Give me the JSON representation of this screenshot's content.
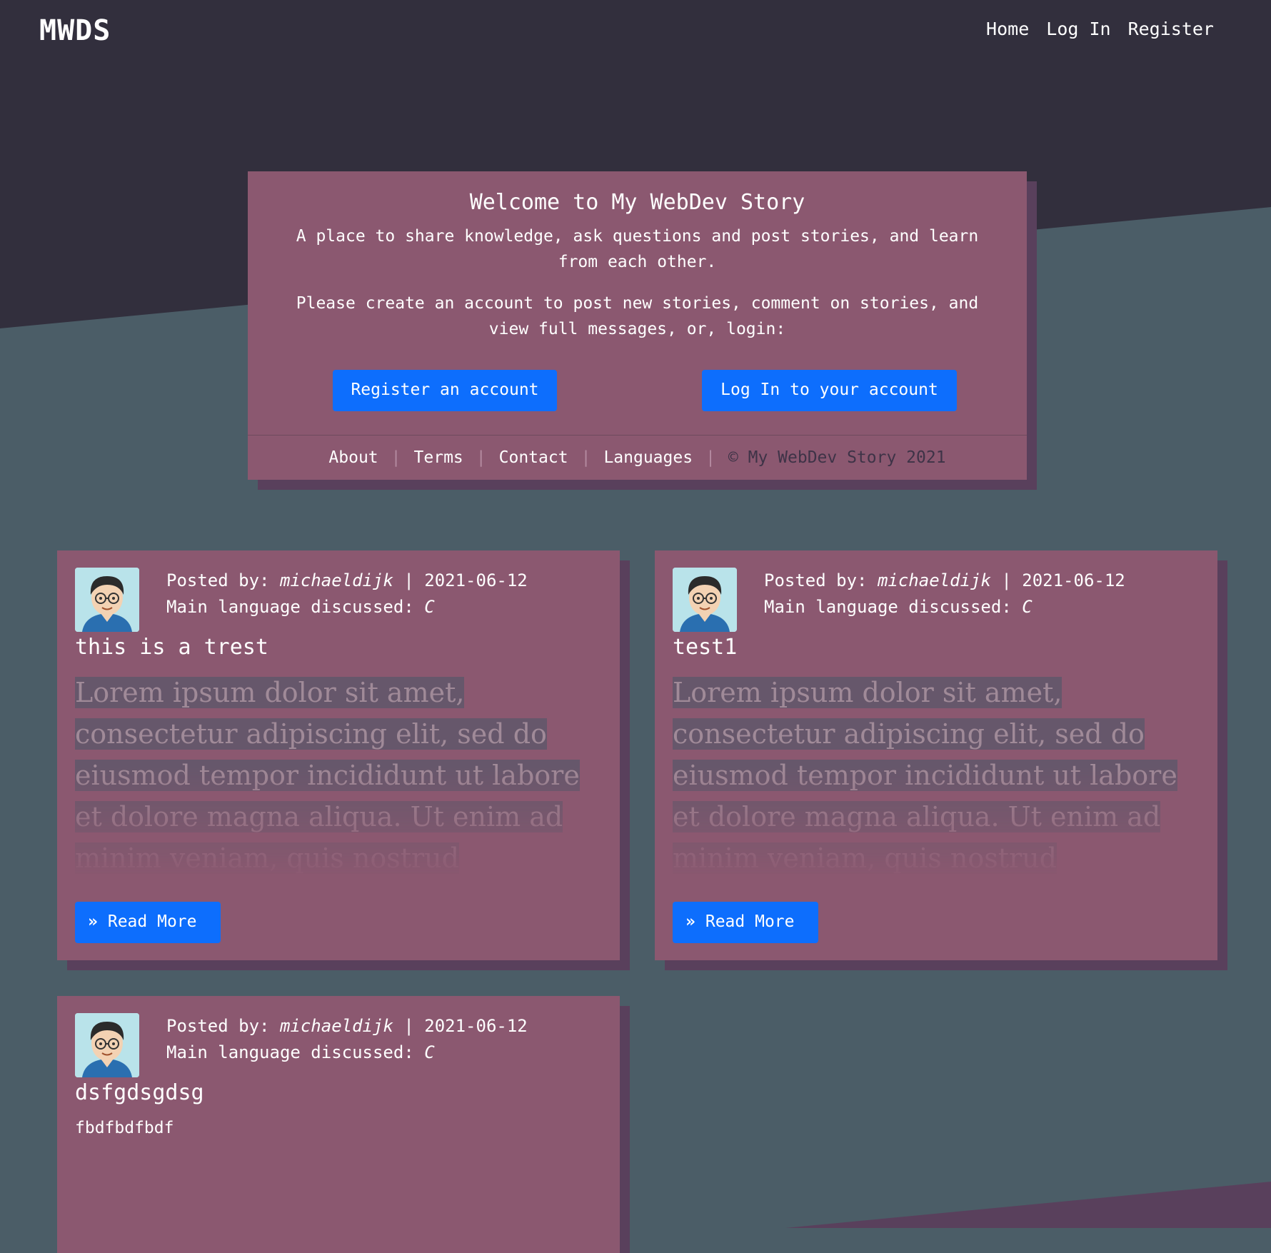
{
  "brand": "MWDS",
  "nav": {
    "home": "Home",
    "login": "Log In",
    "register": "Register"
  },
  "hero": {
    "title": "Welcome to My WebDev Story",
    "tagline": "A place to share knowledge, ask questions and post stories, and learn from each other.",
    "cta_text": "Please create an account to post new stories, comment on stories, and view full messages, or, login:",
    "register_button": "Register an account",
    "login_button": "Log In to your account",
    "footer": {
      "about": "About",
      "terms": "Terms",
      "contact": "Contact",
      "languages": "Languages",
      "separator": "|",
      "copyright": "© My WebDev Story 2021"
    }
  },
  "posts": [
    {
      "posted_by_label": "Posted by:",
      "author": "michaeldijk",
      "date": "| 2021-06-12",
      "lang_label": "Main language discussed:",
      "lang": "C",
      "title": "this is a trest",
      "body": "Lorem ipsum dolor sit amet, consectetur adipiscing elit, sed do eiusmod tempor incididunt ut labore et dolore magna aliqua. Ut enim ad minim veniam, quis nostrud exercitation ullamco laboris nisi",
      "read_more": "Read More"
    },
    {
      "posted_by_label": "Posted by:",
      "author": "michaeldijk",
      "date": "| 2021-06-12",
      "lang_label": "Main language discussed:",
      "lang": "C",
      "title": "test1",
      "body": "Lorem ipsum dolor sit amet, consectetur adipiscing elit, sed do eiusmod tempor incididunt ut labore et dolore magna aliqua. Ut enim ad minim veniam, quis nostrud exercitation ullamco laboris nisi",
      "read_more": "Read More"
    },
    {
      "posted_by_label": "Posted by:",
      "author": "michaeldijk",
      "date": "| 2021-06-12",
      "lang_label": "Main language discussed:",
      "lang": "C",
      "title": "dsfgdsgdsg",
      "body": "fbdfbdfbdf"
    }
  ],
  "icons": {
    "avatar": "avatar-icon",
    "read_more": "double-chevron-right-icon"
  },
  "colors": {
    "accent": "#0d6efd",
    "card": "#8b5870",
    "bg_dark": "#322f3d",
    "bg_slate": "#4b5d67"
  }
}
